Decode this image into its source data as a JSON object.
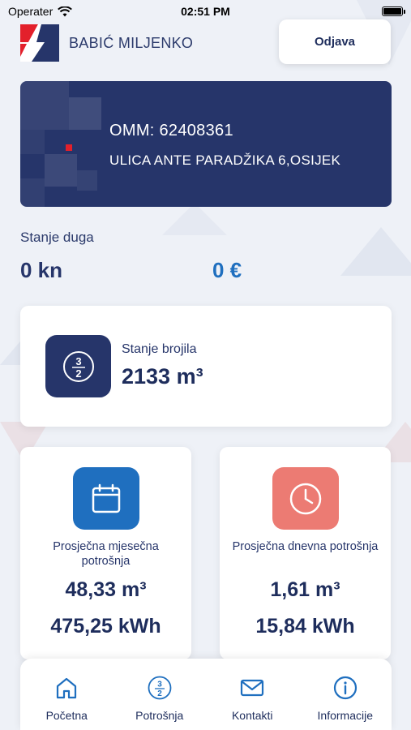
{
  "status_bar": {
    "carrier": "Operater",
    "time": "02:51 PM"
  },
  "header": {
    "user_name": "BABIĆ MILJENKO",
    "logout_label": "Odjava"
  },
  "omm_card": {
    "omm": "OMM: 62408361",
    "address": "ULICA ANTE PARADŽIKA 6,OSIJEK"
  },
  "debt": {
    "label": "Stanje duga",
    "amount_kn": "0 kn",
    "amount_eur": "0 €"
  },
  "meter": {
    "label": "Stanje brojila",
    "value": "2133 m³"
  },
  "monthly": {
    "label": "Prosječna mjesečna potrošnja",
    "value_m3": "48,33 m³",
    "value_kwh": "475,25 kWh"
  },
  "daily": {
    "label": "Prosječna dnevna potrošnja",
    "value_m3": "1,61 m³",
    "value_kwh": "15,84 kWh"
  },
  "nav": {
    "items": [
      {
        "label": "Početna",
        "icon": "home-icon"
      },
      {
        "label": "Potrošnja",
        "icon": "fraction-icon"
      },
      {
        "label": "Kontakti",
        "icon": "mail-icon"
      },
      {
        "label": "Informacije",
        "icon": "info-icon"
      }
    ]
  },
  "colors": {
    "primary": "#26356a",
    "accent_blue": "#1f6fbf",
    "accent_red": "#e3202b",
    "salmon": "#ec7b73",
    "nav_blue": "#1f6fbf"
  }
}
